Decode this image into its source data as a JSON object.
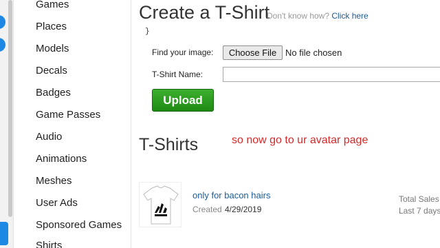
{
  "sidebar": {
    "items": [
      {
        "label": "Games"
      },
      {
        "label": "Places"
      },
      {
        "label": "Models"
      },
      {
        "label": "Decals"
      },
      {
        "label": "Badges"
      },
      {
        "label": "Game Passes"
      },
      {
        "label": "Audio"
      },
      {
        "label": "Animations"
      },
      {
        "label": "Meshes"
      },
      {
        "label": "User Ads"
      },
      {
        "label": "Sponsored Games"
      },
      {
        "label": "Shirts"
      }
    ]
  },
  "create": {
    "title": "Create a T-Shirt",
    "help_text": "Don't know how?",
    "help_link": "Click here",
    "brace": "}",
    "find_image_label": "Find your image:",
    "choose_file_label": "Choose File",
    "no_file_text": "No file chosen",
    "name_label": "T-Shirt Name:",
    "name_value": "",
    "upload_label": "Upload"
  },
  "list": {
    "title": "T-Shirts",
    "items": [
      {
        "name": "only for bacon hairs",
        "created_label": "Created",
        "created_date": "4/29/2019",
        "total_sales_label": "Total Sales",
        "last_days_label": "Last 7 days"
      }
    ]
  },
  "overlay_text": "so now go to ur avatar page",
  "colors": {
    "link": "#1a5c9e",
    "upload_green": "#2a9b20",
    "overlay_red": "#d42a2a",
    "accent_blue": "#1e88e5"
  }
}
